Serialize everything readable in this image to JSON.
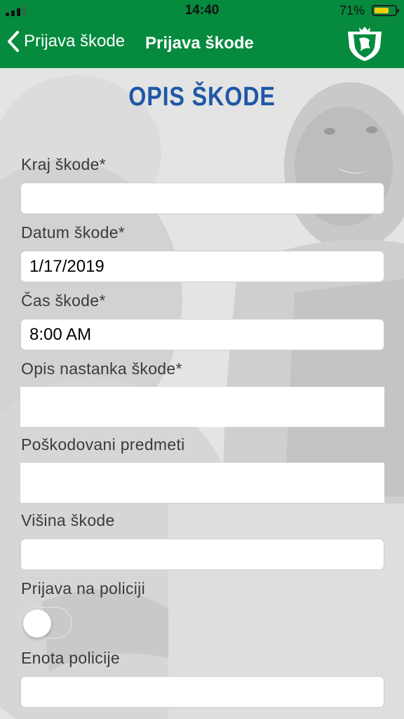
{
  "status_bar": {
    "time": "14:40",
    "battery_percent": "71%",
    "battery_level": 0.71,
    "signal_bars": 4
  },
  "nav": {
    "back_label": "Prijava škode",
    "title": "Prijava škode",
    "logo_icon": "coat-of-arms-shield-icon"
  },
  "form": {
    "heading": "OPIS ŠKODE",
    "fields": [
      {
        "label": "Kraj škode*",
        "value": ""
      },
      {
        "label": "Datum škode*",
        "value": "1/17/2019"
      },
      {
        "label": "Čas škode*",
        "value": "8:00 AM"
      },
      {
        "label": "Opis nastanka škode*",
        "value": ""
      },
      {
        "label": "Poškodovani predmeti",
        "value": ""
      },
      {
        "label": "Višina škode",
        "value": ""
      },
      {
        "label": "Prijava na policiji",
        "toggle_on": false
      },
      {
        "label": "Enota policije",
        "value": ""
      }
    ]
  },
  "colors": {
    "brand_green": "#058a3e",
    "heading_blue": "#1f58a6"
  }
}
